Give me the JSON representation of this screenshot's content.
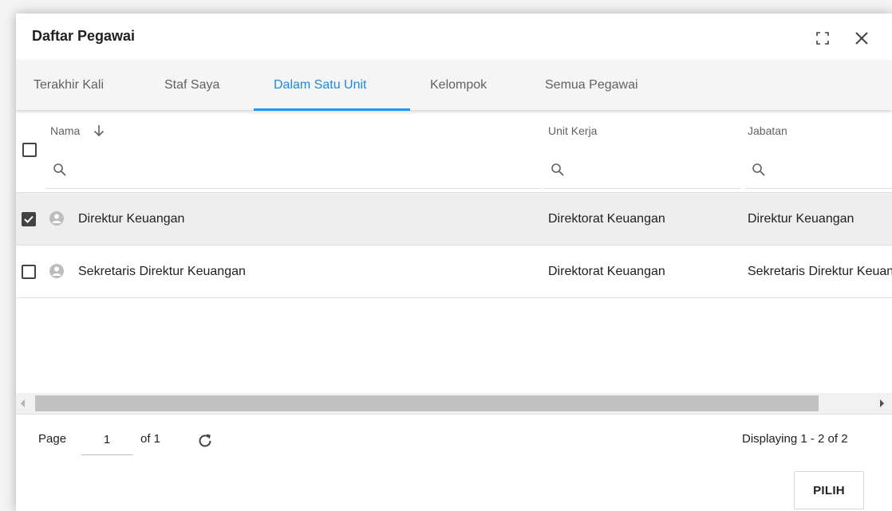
{
  "dialog": {
    "title": "Daftar Pegawai",
    "maximize_icon": "maximize-icon",
    "close_icon": "close-icon"
  },
  "tabs": [
    {
      "label": "Terakhir Kali",
      "active": false
    },
    {
      "label": "Staf Saya",
      "active": false
    },
    {
      "label": "Dalam Satu Unit",
      "active": true
    },
    {
      "label": "Kelompok",
      "active": false
    },
    {
      "label": "Semua Pegawai",
      "active": false
    }
  ],
  "columns": {
    "nama": {
      "title": "Nama",
      "sort": "descending",
      "sort_icon": "arrow-down-icon",
      "filter_placeholder": ""
    },
    "unit_kerja": {
      "title": "Unit Kerja",
      "filter_placeholder": ""
    },
    "jabatan": {
      "title": "Jabatan",
      "filter_placeholder": ""
    }
  },
  "rows": [
    {
      "checked": true,
      "nama": "Direktur Keuangan",
      "unit_kerja": "Direktorat Keuangan",
      "jabatan": "Direktur Keuangan"
    },
    {
      "checked": false,
      "nama": "Sekretaris Direktur Keuangan",
      "unit_kerja": "Direktorat Keuangan",
      "jabatan": "Sekretaris Direktur Keuangan"
    }
  ],
  "pagination": {
    "page_label": "Page",
    "page_value": "1",
    "of_label": "of 1",
    "refresh_icon": "refresh-icon",
    "displaying": "Displaying 1 - 2 of 2"
  },
  "footer": {
    "submit_label": "PILIH"
  },
  "colors": {
    "accent": "#2196f3",
    "active_tab_text": "#1e88e5",
    "selected_row": "#eeeeee",
    "tab_bar": "#f5f5f5"
  }
}
